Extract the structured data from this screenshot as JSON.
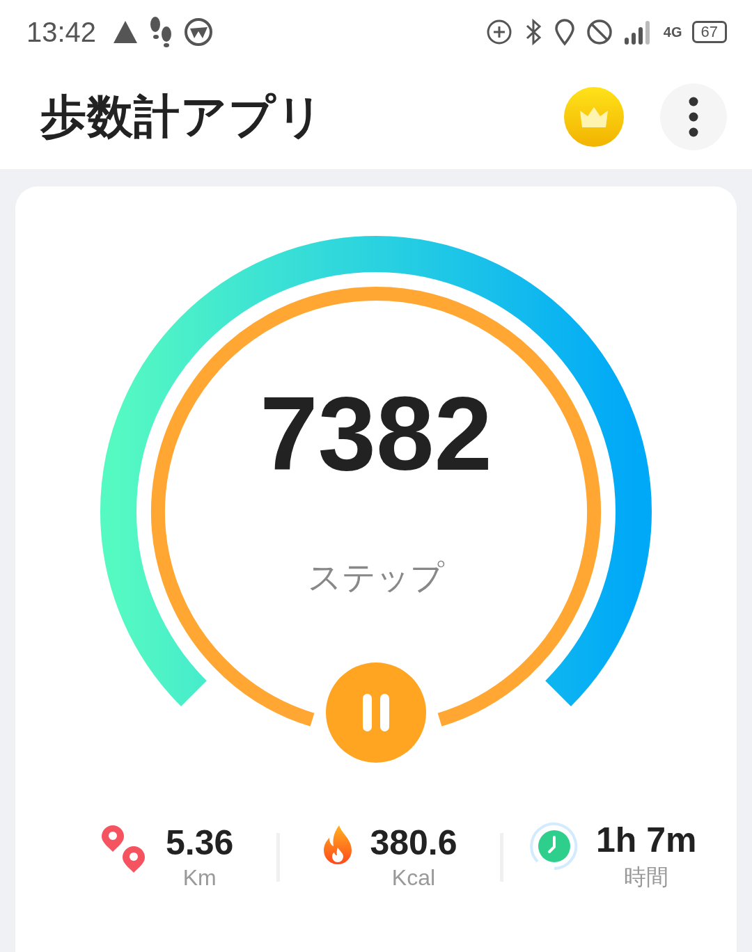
{
  "status_bar": {
    "time": "13:42",
    "network": "4G",
    "battery": "67"
  },
  "header": {
    "title": "歩数計アプリ"
  },
  "gauge": {
    "steps": "7382",
    "label": "ステップ"
  },
  "stats": [
    {
      "kind": "distance",
      "value": "5.36",
      "unit": "Km"
    },
    {
      "kind": "calories",
      "value": "380.6",
      "unit": "Kcal"
    },
    {
      "kind": "time",
      "value": "1h 7m",
      "unit": "時間"
    }
  ]
}
